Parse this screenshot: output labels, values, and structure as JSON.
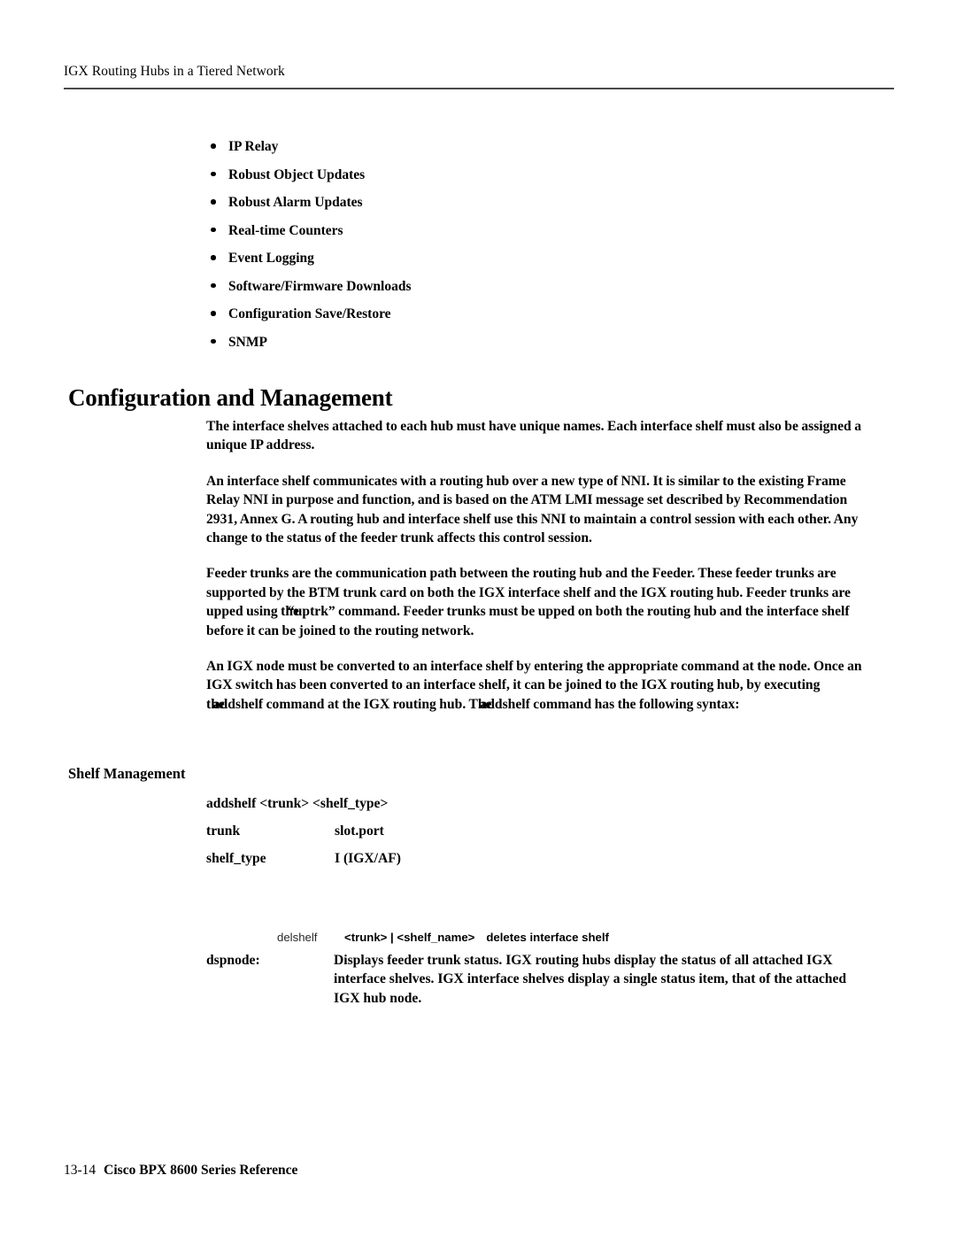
{
  "header": {
    "running_head": "IGX Routing Hubs in a Tiered Network"
  },
  "bullets": {
    "items": [
      {
        "label": "IP Relay"
      },
      {
        "label": "Robust Object Updates"
      },
      {
        "label": "Robust Alarm Updates"
      },
      {
        "label": "Real-time Counters"
      },
      {
        "label": "Event Logging"
      },
      {
        "label": "Software/Firmware Downloads"
      },
      {
        "label": "Configuration Save/Restore"
      },
      {
        "label": "SNMP"
      }
    ]
  },
  "sections": {
    "heading": "Configuration and Management",
    "paragraphs": {
      "p1": "The interface shelves attached to each hub must have unique names. Each interface shelf must also be assigned a unique IP address.",
      "p2": "An interface shelf communicates with a routing hub over a new type of NNI. It is similar to the existing Frame Relay NNI in purpose and function, and is based on the ATM LMI message set described by Recommendation 2931, Annex G. A routing hub and interface shelf use this NNI to maintain a control session with each other. Any change to the status of the feeder trunk affects this control session.",
      "p3_part1": "Feeder trunks are the communication path between the routing hub and the Feeder. These feeder trunks are supported by the BTM trunk card on both the IGX interface shelf and the IGX routing hub. Feeder trunks are upped using the",
      "p3_cmd": "“uptrk”",
      "p3_part2": " command. Feeder trunks must be upped on both the routing hub and the interface shelf before it can be joined to the routing network.",
      "p4_part1": "An IGX node must be converted to an interface shelf by entering the appropriate command at the node. Once an IGX switch has been converted to an interface shelf, it can be joined to the IGX routing hub, by executing the",
      "p4_cmd1": "addshelf",
      "p4_part2": " command at the IGX routing hub. The",
      "p4_cmd2": "addshelf",
      "p4_part3": " command has the following syntax:"
    }
  },
  "shelf_management": {
    "heading": "Shelf Management",
    "syntax_lines": [
      {
        "col_a": "addshelf <trunk> <shelf_type>",
        "col_b": ""
      },
      {
        "col_a": "trunk",
        "col_b": "slot.port"
      },
      {
        "col_a": "shelf_type",
        "col_b": "I (IGX/AF)"
      }
    ],
    "delshelf": {
      "command": "delshelf",
      "arguments": "<trunk> | <shelf_name>",
      "description": "deletes interface shelf"
    },
    "dspnode": {
      "label": "dspnode:",
      "description": "Displays feeder trunk status. IGX routing hubs display the status of all attached IGX interface shelves. IGX interface shelves display a single status item, that of the attached IGX hub node."
    }
  },
  "footer": {
    "page_number": "13-14",
    "document_title": "Cisco BPX 8600 Series Reference"
  }
}
